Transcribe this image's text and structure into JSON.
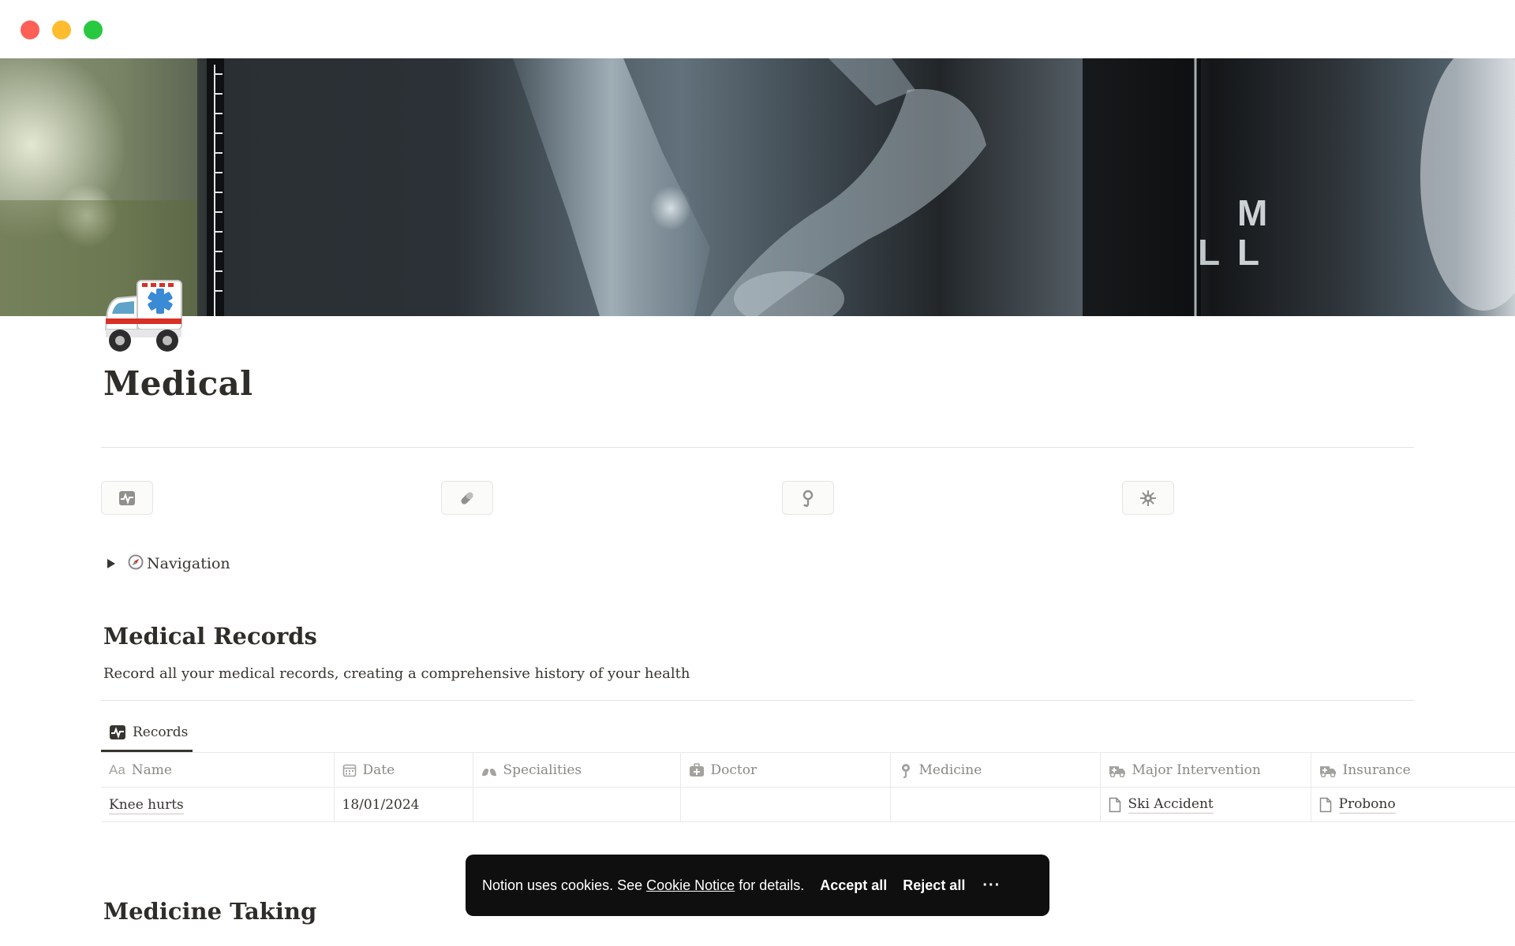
{
  "page": {
    "title": "Medical"
  },
  "nav_icons": [
    "pulse-icon",
    "pill-icon",
    "stethoscope-icon",
    "virus-icon"
  ],
  "navigation_toggle": {
    "label": "Navigation",
    "icon": "compass-icon"
  },
  "medical_records": {
    "heading": "Medical Records",
    "description": "Record all your medical records, creating a comprehensive history of your health",
    "view_tab": "Records",
    "columns": [
      "Name",
      "Date",
      "Specialities",
      "Doctor",
      "Medicine",
      "Major Intervention",
      "Insurance"
    ],
    "rows": [
      {
        "name": "Knee hurts",
        "date": "18/01/2024",
        "specialities": "",
        "doctor": "",
        "medicine": "",
        "major_intervention": "Ski Accident",
        "insurance": "Probono"
      }
    ]
  },
  "medicine_taking": {
    "heading": "Medicine Taking"
  },
  "cookie_banner": {
    "message_before": "Notion uses cookies. See ",
    "link": "Cookie Notice",
    "message_after": " for details.",
    "accept": "Accept all",
    "reject": "Reject all",
    "more": "···"
  },
  "colors": {
    "text": "#37352f",
    "muted": "#8a8985",
    "toast_bg": "#0f0f0f",
    "divider": "#e3e2df"
  }
}
